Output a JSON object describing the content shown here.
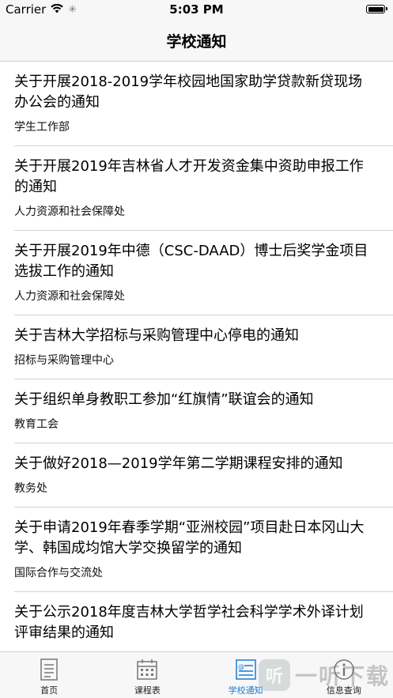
{
  "status_bar": {
    "carrier": "Carrier",
    "time": "5:03 PM"
  },
  "nav": {
    "title": "学校通知"
  },
  "notices": [
    {
      "title": "关于开展2018-2019学年校园地国家助学贷款新贷现场办公会的通知",
      "dept": "学生工作部"
    },
    {
      "title": "关于开展2019年吉林省人才开发资金集中资助申报工作的通知",
      "dept": "人力资源和社会保障处"
    },
    {
      "title": "关于开展2019年中德（CSC-DAAD）博士后奖学金项目选拔工作的通知",
      "dept": "人力资源和社会保障处"
    },
    {
      "title": "关于吉林大学招标与采购管理中心停电的通知",
      "dept": "招标与采购管理中心"
    },
    {
      "title": "关于组织单身教职工参加“红旗情”联谊会的通知",
      "dept": "教育工会"
    },
    {
      "title": "关于做好2018—2019学年第二学期课程安排的通知",
      "dept": "教务处"
    },
    {
      "title": "关于申请2019年春季学期“亚洲校园”项目赴日本冈山大学、韩国成均馆大学交换留学的通知",
      "dept": "国际合作与交流处"
    },
    {
      "title": "关于公示2018年度吉林大学哲学社会科学学术外译计划评审结果的通知",
      "dept": ""
    }
  ],
  "tabs": [
    {
      "label": "首页",
      "icon": "document-icon",
      "active": false
    },
    {
      "label": "课程表",
      "icon": "calendar-icon",
      "active": false
    },
    {
      "label": "学校通知",
      "icon": "notice-icon",
      "active": true
    },
    {
      "label": "信息查询",
      "icon": "info-icon",
      "active": false
    }
  ],
  "watermark": {
    "logo_glyph": "听",
    "text": "一听下载"
  },
  "colors": {
    "accent": "#1a7ad8",
    "bar_bg": "#f7f7f7",
    "separator": "#d4d4d4"
  }
}
